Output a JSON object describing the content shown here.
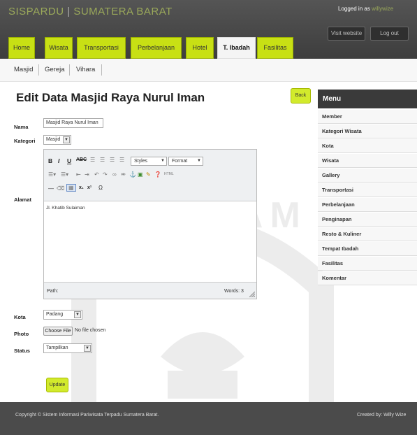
{
  "header": {
    "brand_left": "SISPARDU",
    "brand_sep": "|",
    "brand_right": "SUMATERA BARAT",
    "logged_prefix": "Logged in as",
    "logged_user": "willywize",
    "visit_label": "Visit website",
    "logout_label": "Log out"
  },
  "nav": {
    "tabs": [
      "Home",
      "Wisata",
      "Transportasi",
      "Perbelanjaan",
      "Hotel",
      "T. Ibadah",
      "Fasilitas"
    ],
    "active_tab": "T. Ibadah"
  },
  "subnav": {
    "items": [
      "Masjid",
      "Gereja",
      "Vihara"
    ]
  },
  "page": {
    "title": "Edit Data Masjid Raya Nurul Iman",
    "back_label": "Back"
  },
  "form": {
    "nama_label": "Nama",
    "nama_value": "Masjid Raya Nurul Iman",
    "kategori_label": "Kategori",
    "kategori_value": "Masjid",
    "alamat_label": "Alamat",
    "alamat_value": "Jl. Khatib Sulaiman",
    "kota_label": "Kota",
    "kota_value": "Padang",
    "photo_label": "Photo",
    "choose_file_label": "Choose File",
    "no_file_text": "No file chosen",
    "status_label": "Status",
    "status_value": "Tampilkan",
    "update_label": "Update"
  },
  "editor": {
    "styles_label": "Styles",
    "format_label": "Format",
    "path_label": "Path:",
    "words_label": "Words: 3"
  },
  "sidebar": {
    "title": "Menu",
    "items": [
      "Member",
      "Kategori Wisata",
      "Kota",
      "Wisata",
      "Gallery",
      "Transportasi",
      "Perbelanjaan",
      "Penginapan",
      "Resto & Kuliner",
      "Tempat Ibadah",
      "Fasilitas",
      "Komentar"
    ]
  },
  "footer": {
    "copyright": "Copyright © Sistem Informasi Pariwisata Terpadu Sumatera Barat.",
    "credit": "Created by: Willy Wize"
  },
  "watermark": {
    "word": "ISLAM"
  },
  "colors": {
    "accent": "#c8e014",
    "header": "#4a4a4a",
    "footer": "#4b4b4b",
    "menu_head": "#3a3a3a"
  }
}
